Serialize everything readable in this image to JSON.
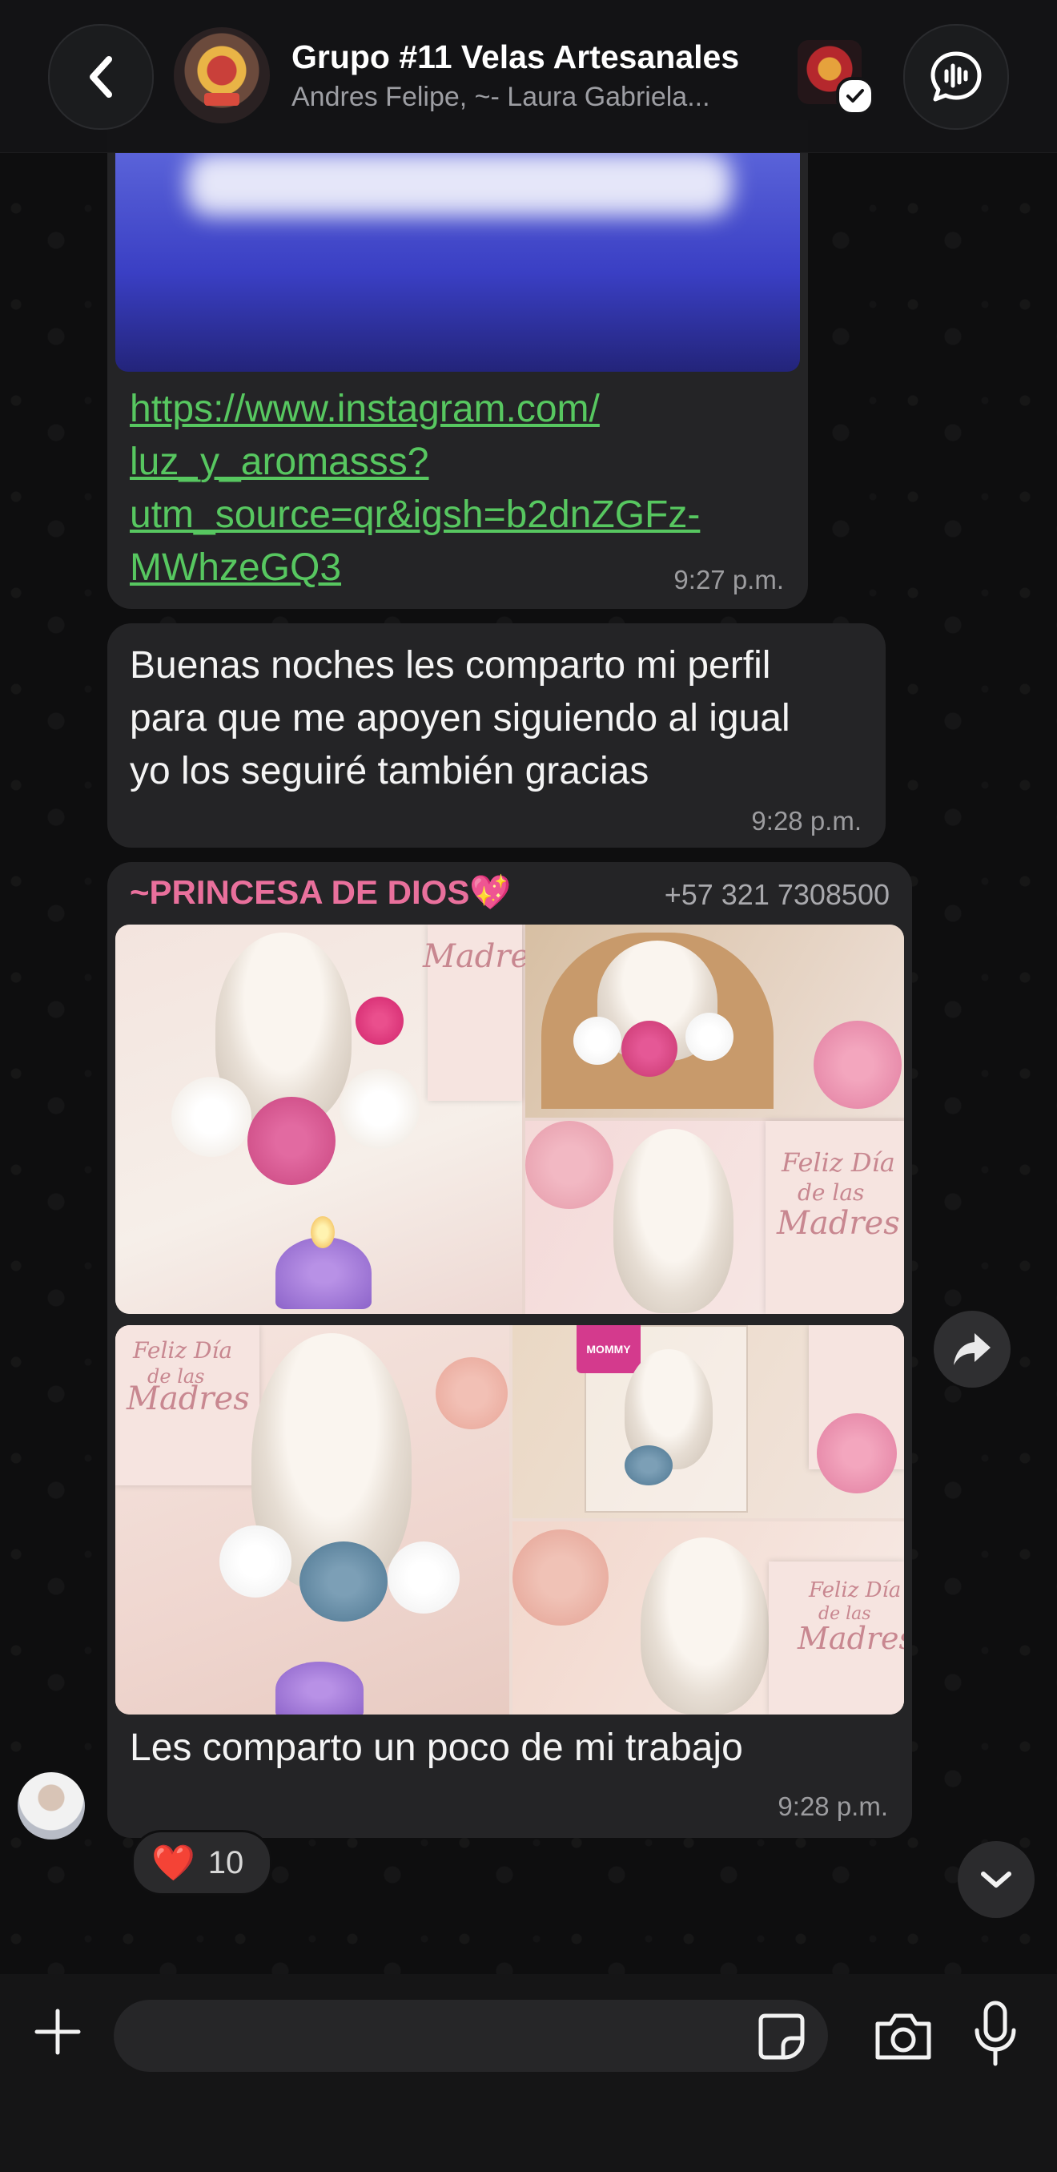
{
  "header": {
    "title": "Grupo #11 Velas Artesanales",
    "subtitle": "Andres Felipe, ~- Laura Gabriela...",
    "back_icon": "chevron-left-icon",
    "call_icon": "group-call-icon"
  },
  "messages": [
    {
      "type": "link",
      "link": "https://www.instagram.com/luz_y_aromasss?utm_source=qr&igsh=b2dnZGFz-MWhzeGQ3",
      "link_lines": [
        "https://www.instagram.com/",
        "luz_y_aromasss?",
        "utm_source=qr&igsh=b2dnZGFz-",
        "MWhzeGQ3"
      ],
      "time": "9:27 p.m."
    },
    {
      "type": "text",
      "text_lines": [
        "Buenas noches les comparto mi perfil",
        "para que me apoyen siguiendo al igual",
        "yo los seguiré también gracias"
      ],
      "time": "9:28 p.m."
    },
    {
      "type": "images",
      "sender": "~PRINCESA DE DIOS💖",
      "phone": "+57 321 7308500",
      "caption": "Les comparto un poco de mi trabajo",
      "time": "9:28 p.m.",
      "card_text": [
        "Madres",
        "Feliz Día",
        "de las",
        "Madres"
      ],
      "tag_text": "MOMMY",
      "reaction": {
        "emoji": "❤️",
        "count": "10"
      }
    }
  ],
  "composer": {
    "placeholder": "",
    "plus_icon": "plus-icon",
    "sticker_icon": "sticker-icon",
    "camera_icon": "camera-icon",
    "mic_icon": "microphone-icon"
  },
  "colors": {
    "link": "#57c760",
    "sender": "#e9709c",
    "bubble": "#242426",
    "background": "#0e0e0f"
  }
}
